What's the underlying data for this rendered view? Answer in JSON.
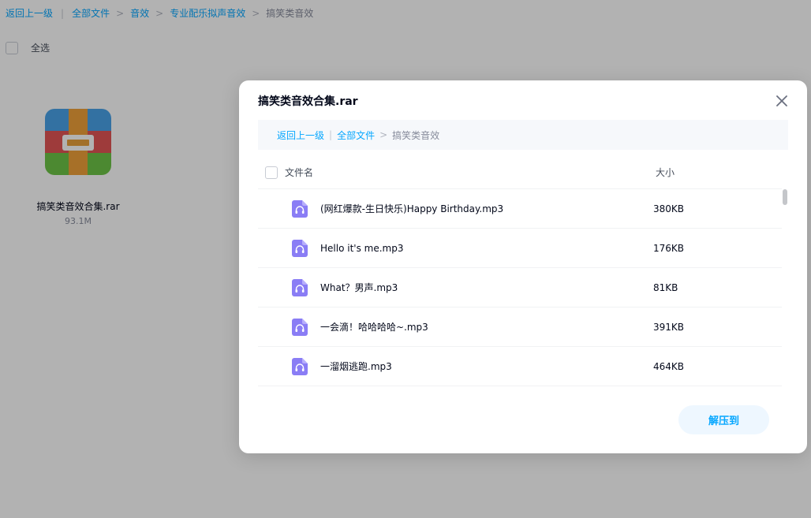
{
  "breadcrumb": {
    "back": "返回上一级",
    "items": [
      "全部文件",
      "音效",
      "专业配乐拟声音效"
    ],
    "current": "搞笑类音效"
  },
  "select_all": "全选",
  "background_file": {
    "name": "搞笑类音效合集.rar",
    "size": "93.1M",
    "icon": "archive-icon"
  },
  "dialog": {
    "title": "搞笑类音效合集.rar",
    "breadcrumb": {
      "back": "返回上一级",
      "root": "全部文件",
      "current": "搞笑类音效"
    },
    "columns": {
      "name": "文件名",
      "size": "大小"
    },
    "files": [
      {
        "name": "(网红爆款-生日快乐)Happy Birthday.mp3",
        "size": "380KB"
      },
      {
        "name": "Hello it's me.mp3",
        "size": "176KB"
      },
      {
        "name": "What？男声.mp3",
        "size": "81KB"
      },
      {
        "name": "一会滴！哈哈哈哈~.mp3",
        "size": "391KB"
      },
      {
        "name": "一溜烟逃跑.mp3",
        "size": "464KB"
      }
    ],
    "extract_button": "解压到"
  },
  "colors": {
    "accent": "#06a7ff",
    "audio_icon": "#8a7df5"
  }
}
